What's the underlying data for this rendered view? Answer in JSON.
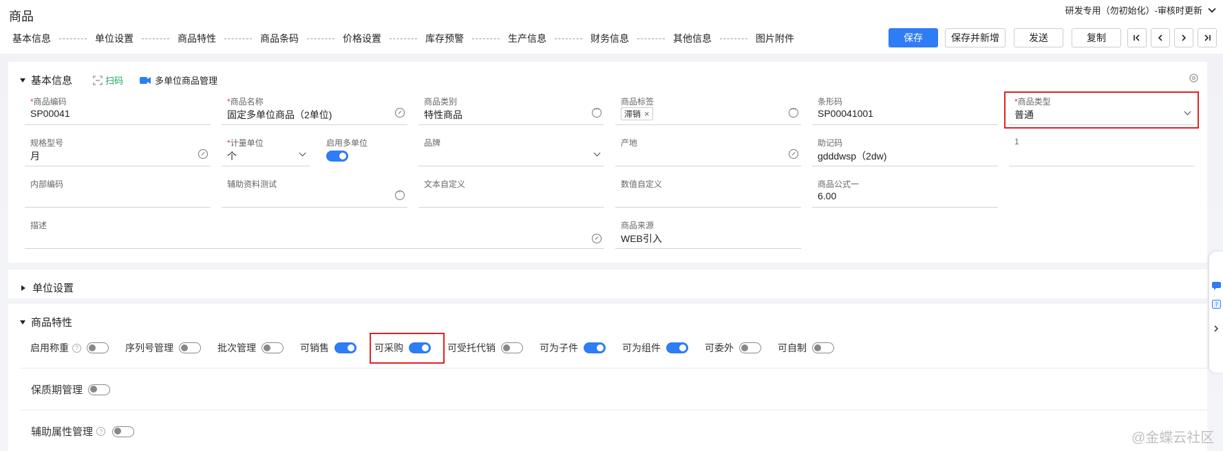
{
  "page_title": "商品",
  "org_selector": "研发专用（勿初始化）-审核时更新",
  "nav_tabs": [
    "基本信息",
    "单位设置",
    "商品特性",
    "商品条码",
    "价格设置",
    "库存预警",
    "生产信息",
    "财务信息",
    "其他信息",
    "图片附件"
  ],
  "actions": {
    "save": "保存",
    "save_new": "保存并新增",
    "send": "发送",
    "copy": "复制"
  },
  "basic": {
    "title": "基本信息",
    "scan": "扫码",
    "multi_unit": "多单位商品管理",
    "fields": {
      "code": {
        "label": "商品编码",
        "value": "SP00041"
      },
      "name": {
        "label": "商品名称",
        "value": "固定多单位商品（2单位)"
      },
      "category": {
        "label": "商品类别",
        "value": "特性商品"
      },
      "tags": {
        "label": "商品标签",
        "value": "滞销"
      },
      "barcode": {
        "label": "条形码",
        "value": "SP00041001"
      },
      "type": {
        "label": "商品类型",
        "value": "普通"
      },
      "spec": {
        "label": "规格型号",
        "value": "月"
      },
      "unit": {
        "label": "计量单位",
        "value": "个"
      },
      "multiunit": {
        "label": "启用多单位"
      },
      "brand": {
        "label": "品牌",
        "value": ""
      },
      "origin": {
        "label": "产地",
        "value": ""
      },
      "mnemonic": {
        "label": "助记码",
        "value": "gdddwsp（2dw)"
      },
      "f1": {
        "label": "1",
        "value": ""
      },
      "internal": {
        "label": "内部编码",
        "value": ""
      },
      "aux": {
        "label": "辅助资料测试",
        "value": ""
      },
      "text_custom": {
        "label": "文本自定义",
        "value": ""
      },
      "num_custom": {
        "label": "数值自定义",
        "value": ""
      },
      "formula": {
        "label": "商品公式一",
        "value": "6.00"
      },
      "desc": {
        "label": "描述",
        "value": ""
      },
      "source": {
        "label": "商品来源",
        "value": "WEB引入"
      }
    }
  },
  "unit_section": {
    "title": "单位设置"
  },
  "features": {
    "title": "商品特性",
    "items": [
      {
        "label": "启用称重",
        "on": false,
        "help": true
      },
      {
        "label": "序列号管理",
        "on": false
      },
      {
        "label": "批次管理",
        "on": false
      },
      {
        "label": "可销售",
        "on": true
      },
      {
        "label": "可采购",
        "on": true
      },
      {
        "label": "可受托代销",
        "on": false
      },
      {
        "label": "可为子件",
        "on": true
      },
      {
        "label": "可为组件",
        "on": true
      },
      {
        "label": "可委外",
        "on": false
      },
      {
        "label": "可自制",
        "on": false
      }
    ],
    "shelf_life": "保质期管理",
    "aux_attr": "辅助属性管理"
  },
  "watermark": "@金蝶云社区"
}
